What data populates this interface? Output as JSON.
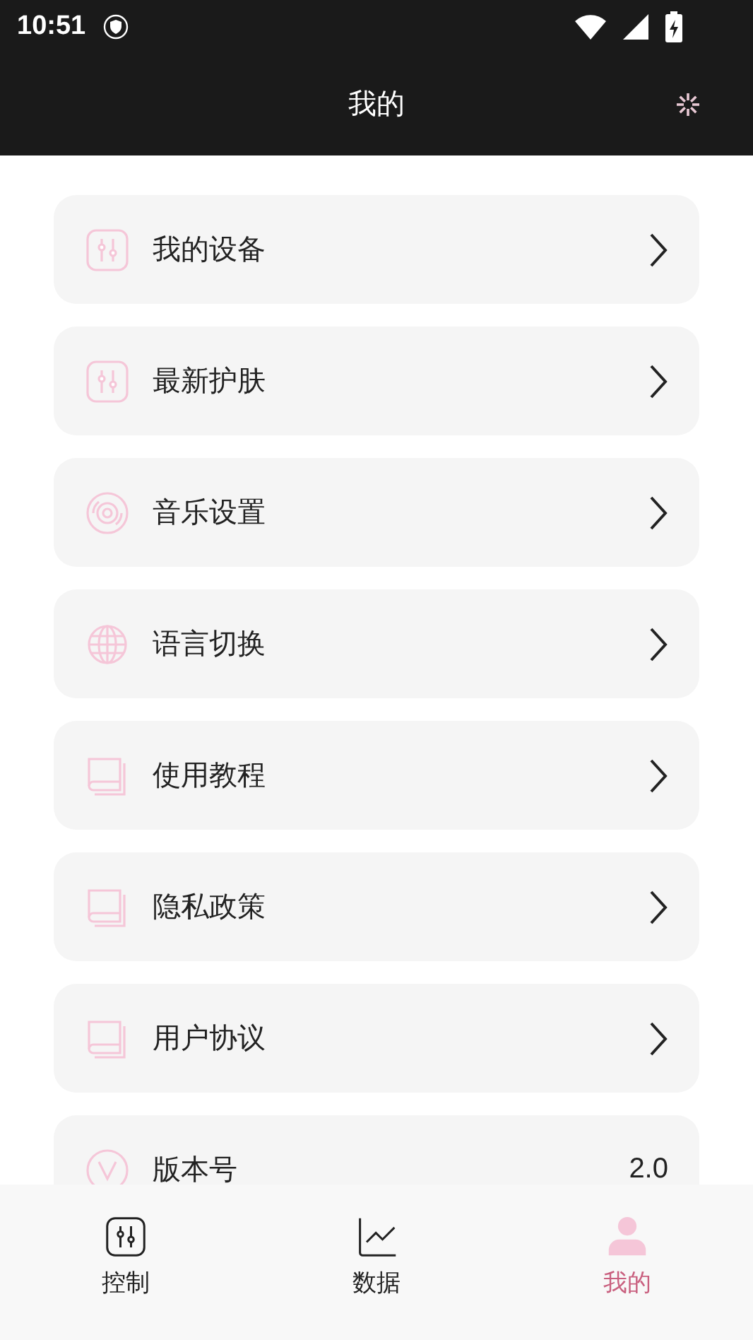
{
  "status_bar": {
    "time": "10:51"
  },
  "header": {
    "title": "我的"
  },
  "menu": [
    {
      "label": "我的设备",
      "kind": "link"
    },
    {
      "label": "最新护肤",
      "kind": "link"
    },
    {
      "label": "音乐设置",
      "kind": "link"
    },
    {
      "label": "语言切换",
      "kind": "link"
    },
    {
      "label": "使用教程",
      "kind": "link"
    },
    {
      "label": "隐私政策",
      "kind": "link"
    },
    {
      "label": "用户协议",
      "kind": "link"
    },
    {
      "label": "版本号",
      "kind": "value",
      "value": "2.0"
    }
  ],
  "tabs": [
    {
      "label": "控制",
      "selected": false
    },
    {
      "label": "数据",
      "selected": false
    },
    {
      "label": "我的",
      "selected": true
    }
  ]
}
